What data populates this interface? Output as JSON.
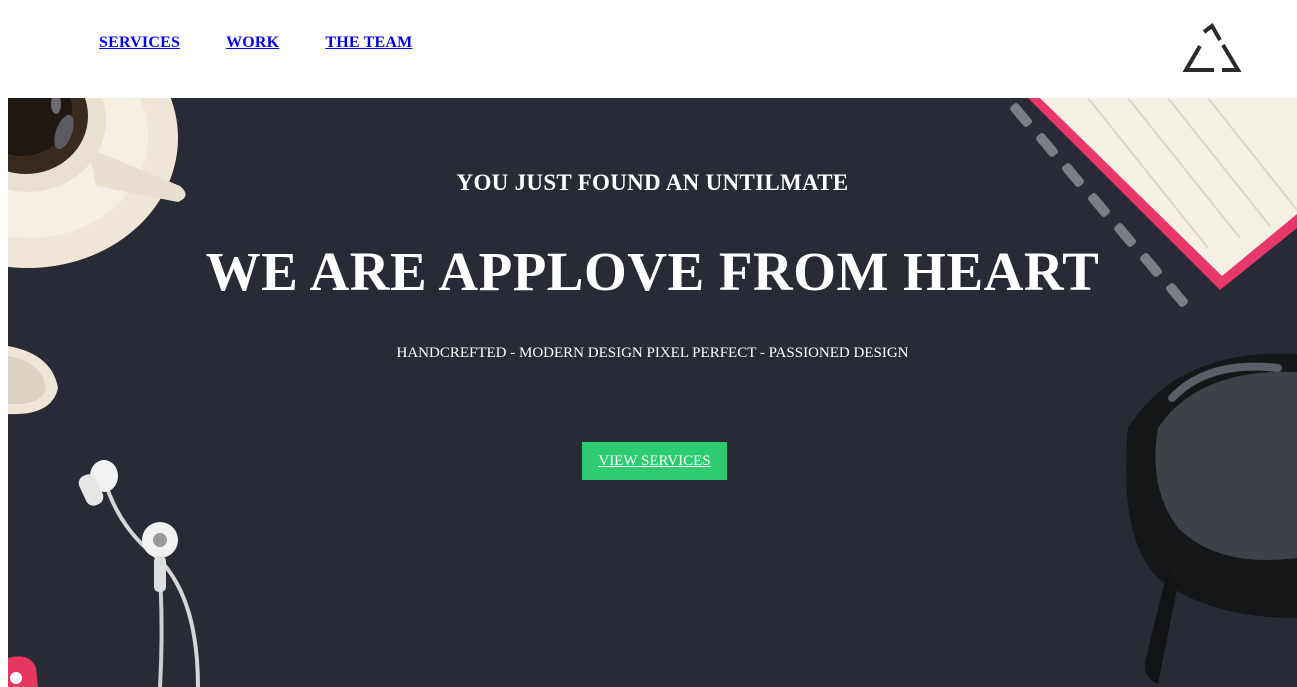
{
  "nav": {
    "items": [
      {
        "label": "SERVICES"
      },
      {
        "label": "WORK"
      },
      {
        "label": "THE TEAM"
      }
    ],
    "logo_icon": "triangle-logo-icon"
  },
  "hero": {
    "tagline": "YOU JUST FOUND AN UNTILMATE",
    "headline": "WE ARE APPLOVE FROM HEART",
    "subline": "HANDCREFTED - MODERN DESIGN PIXEL PERFECT - PASSIONED DESIGN",
    "cta_label": "VIEW SERVICES",
    "background_color": "#282b35",
    "cta_color": "#2ecc71"
  }
}
